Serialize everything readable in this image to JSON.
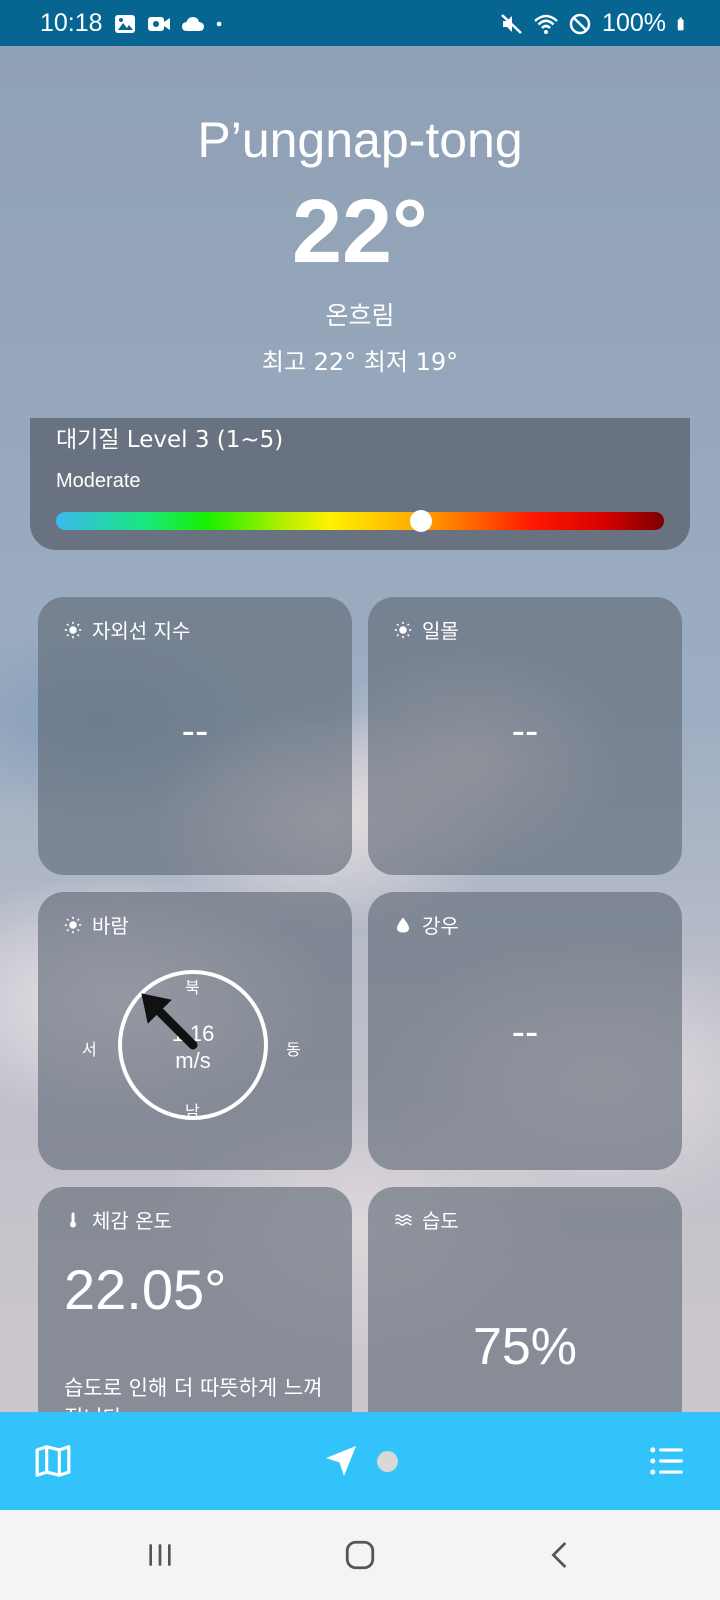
{
  "status_bar": {
    "time": "10:18",
    "battery": "100%",
    "left_icons": [
      "gallery-icon",
      "video-icon",
      "cloud-icon",
      "dot-icon"
    ],
    "right_icons": [
      "mute-icon",
      "wifi-icon",
      "block-icon",
      "battery-icon"
    ]
  },
  "location": {
    "city": "P’ungnap-tong"
  },
  "weather": {
    "temperature": "22°",
    "condition": "온흐림",
    "high_low": "최고 22°   최저 19°"
  },
  "air_quality": {
    "title": "대기질 Level 3 (1~5)",
    "status": "Moderate",
    "level_fraction": 0.6
  },
  "cards": {
    "uv": {
      "title": "자외선 지수",
      "value": "--",
      "icon": "sun-icon"
    },
    "sunset": {
      "title": "일몰",
      "value": "--",
      "icon": "sun-icon"
    },
    "wind": {
      "title": "바람",
      "icon": "sun-icon",
      "speed_value": "1.16",
      "speed_unit": "m/s",
      "north": "북",
      "south": "남",
      "east": "동",
      "west": "서",
      "direction_deg": 315
    },
    "precipitation": {
      "title": "강우",
      "value": "--",
      "icon": "drop-icon"
    },
    "feels_like": {
      "title": "체감 온도",
      "icon": "thermometer-icon",
      "value": "22.05°",
      "description": "습도로 인해 더 따뜻하게 느껴집니다"
    },
    "humidity": {
      "title": "습도",
      "icon": "waves-icon",
      "value": "75%"
    }
  },
  "bottom_nav": {
    "items": [
      "map-icon",
      "location-arrow-icon",
      "page-dot",
      "list-icon"
    ]
  },
  "colors": {
    "status_bar": "#066691",
    "bottom_nav": "#33c3fb",
    "card_bg": "#5f6976"
  }
}
